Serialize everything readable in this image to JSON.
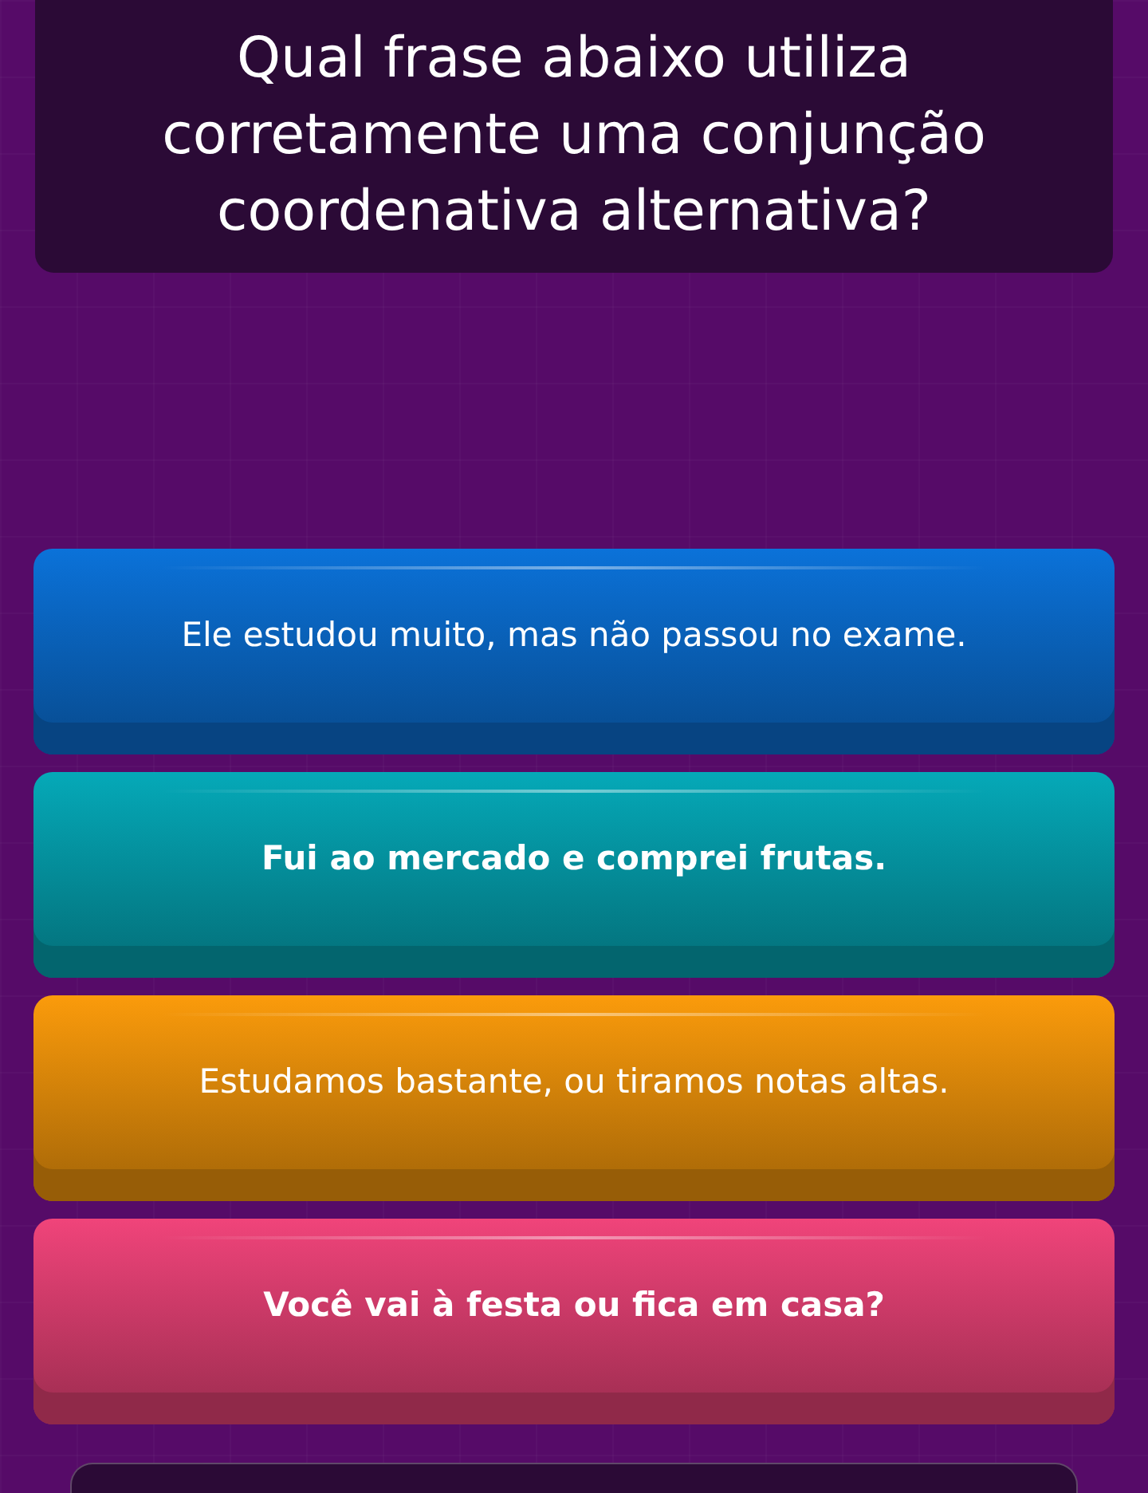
{
  "question": "Qual frase abaixo utiliza corretamente uma conjunção coordenativa alternativa?",
  "options": [
    {
      "text": "Ele estudou muito, mas não passou no exame.",
      "color": "#0b72d9",
      "bold": false
    },
    {
      "text": "Fui ao mercado e comprei frutas.",
      "color": "#05a9b8",
      "bold": true
    },
    {
      "text": "Estudamos bastante, ou tiramos notas altas.",
      "color": "#fb9b0b",
      "bold": false
    },
    {
      "text": "Você vai à festa ou fica em casa?",
      "color": "#f0447a",
      "bold": true
    }
  ]
}
